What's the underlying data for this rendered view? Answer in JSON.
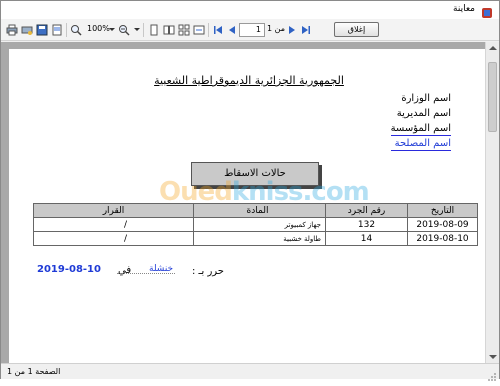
{
  "window": {
    "title": "معاينة"
  },
  "toolbar": {
    "zoom": "100%",
    "page_current": "1",
    "page_of": "من 1",
    "close_label": "إغلاق"
  },
  "report": {
    "title": "الجمهورية الجزائرية الديموقراطية الشعبية",
    "hierarchy": [
      "اسم الوزارة",
      "اسم المديرية",
      "اسم المؤسسة",
      "اسم المصلحة"
    ],
    "banner": "حالات الاسقاط",
    "table": {
      "headers": [
        "التاريخ",
        "رقم الجرد",
        "المادة",
        "القرار"
      ],
      "rows": [
        [
          "2019-08-09",
          "132",
          "جهاز كمبيوتر",
          "/"
        ],
        [
          "2019-08-10",
          "14",
          "طاولة خشبية",
          "/"
        ]
      ]
    },
    "signature": {
      "label": "حرر بـ :",
      "place": "خنشلة",
      "in_word": "في",
      "date": "2019-08-10"
    }
  },
  "watermark": {
    "part1": "Oued",
    "part2": "kniss.com"
  },
  "status": {
    "text": "الصفحة 1 من 1"
  },
  "colors": {
    "link_blue": "#1f3bd6",
    "header_gray": "#c9c9c9"
  }
}
